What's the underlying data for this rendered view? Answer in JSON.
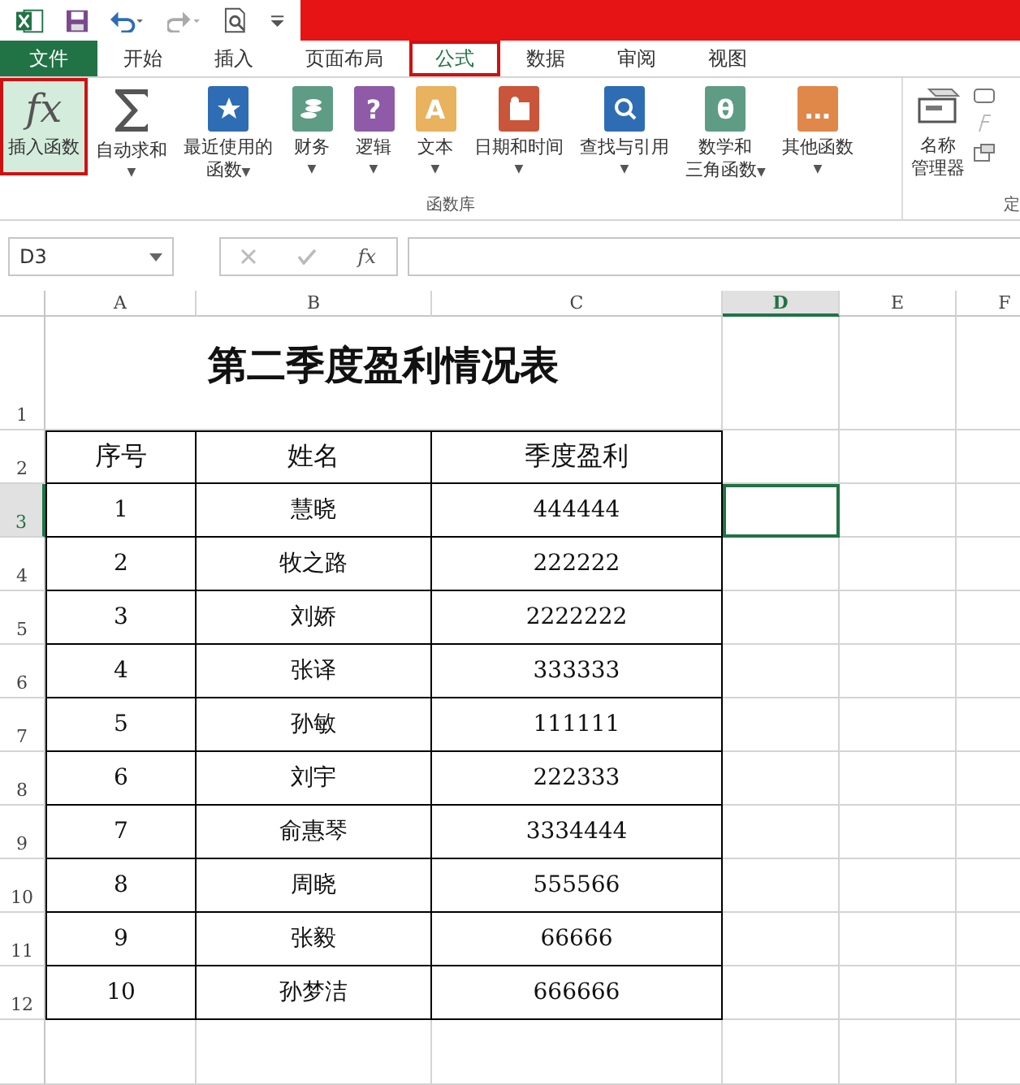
{
  "tabs": [
    {
      "label": "文件",
      "kind": "file",
      "selected": false,
      "highlighted": false
    },
    {
      "label": "开始",
      "kind": "tab",
      "selected": false,
      "highlighted": false
    },
    {
      "label": "插入",
      "kind": "tab",
      "selected": false,
      "highlighted": false
    },
    {
      "label": "页面布局",
      "kind": "tab",
      "selected": false,
      "highlighted": false
    },
    {
      "label": "公式",
      "kind": "tab",
      "selected": true,
      "highlighted": true
    },
    {
      "label": "数据",
      "kind": "tab",
      "selected": false,
      "highlighted": false
    },
    {
      "label": "审阅",
      "kind": "tab",
      "selected": false,
      "highlighted": false
    },
    {
      "label": "视图",
      "kind": "tab",
      "selected": false,
      "highlighted": false
    }
  ],
  "ribbon": {
    "buttons": [
      {
        "lines": [
          "插入函数"
        ],
        "glyph": "fx",
        "highlighted": true
      },
      {
        "lines": [
          "自动求和"
        ],
        "caret": "▼",
        "highlighted": false
      },
      {
        "lines": [
          "最近使用的",
          "函数"
        ],
        "caret": "▼",
        "highlighted": false
      },
      {
        "lines": [
          "财务"
        ],
        "caret": "▼",
        "highlighted": false
      },
      {
        "lines": [
          "逻辑"
        ],
        "glyph": "?",
        "caret": "▼",
        "highlighted": false
      },
      {
        "lines": [
          "文本"
        ],
        "glyph": "A",
        "caret": "▼",
        "highlighted": false
      },
      {
        "lines": [
          "日期和时间"
        ],
        "caret": "▼",
        "highlighted": false
      },
      {
        "lines": [
          "查找与引用"
        ],
        "caret": "▼",
        "highlighted": false
      },
      {
        "lines": [
          "数学和",
          "三角函数"
        ],
        "glyph": "θ",
        "caret": "▼",
        "highlighted": false
      },
      {
        "lines": [
          "其他函数"
        ],
        "glyph": "…",
        "caret": "▼",
        "highlighted": false
      }
    ],
    "group_label": "函数库",
    "name_manager": [
      "名称",
      "管理器"
    ],
    "next_group_label": "定"
  },
  "name_box": "D3",
  "function_glyph": "fx",
  "columns": [
    {
      "label": "A",
      "selected": false
    },
    {
      "label": "B",
      "selected": false
    },
    {
      "label": "C",
      "selected": false
    },
    {
      "label": "D",
      "selected": true
    },
    {
      "label": "E",
      "selected": false
    },
    {
      "label": "F",
      "selected": false
    }
  ],
  "title": "第二季度盈利情况表",
  "table": {
    "columns": [
      "序号",
      "姓名",
      "季度盈利"
    ],
    "rows": [
      [
        "1",
        "慧晓",
        "444444"
      ],
      [
        "2",
        "牧之路",
        "222222"
      ],
      [
        "3",
        "刘娇",
        "2222222"
      ],
      [
        "4",
        "张译",
        "333333"
      ],
      [
        "5",
        "孙敏",
        "111111"
      ],
      [
        "6",
        "刘宇",
        "222333"
      ],
      [
        "7",
        "俞惠琴",
        "3334444"
      ],
      [
        "8",
        "周晓",
        "555566"
      ],
      [
        "9",
        "张毅",
        "66666"
      ],
      [
        "10",
        "孙梦洁",
        "666666"
      ]
    ]
  },
  "row_numbers": [
    {
      "label": "1",
      "selected": false
    },
    {
      "label": "2",
      "selected": false
    },
    {
      "label": "3",
      "selected": true
    },
    {
      "label": "4",
      "selected": false
    },
    {
      "label": "5",
      "selected": false
    },
    {
      "label": "6",
      "selected": false
    },
    {
      "label": "7",
      "selected": false
    },
    {
      "label": "8",
      "selected": false
    },
    {
      "label": "9",
      "selected": false
    },
    {
      "label": "10",
      "selected": false
    },
    {
      "label": "11",
      "selected": false
    },
    {
      "label": "12",
      "selected": false
    }
  ]
}
